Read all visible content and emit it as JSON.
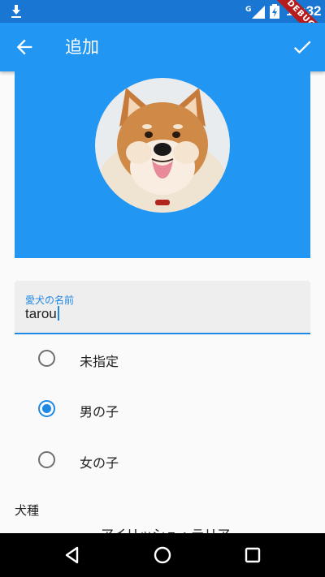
{
  "status_bar": {
    "time": "16:32",
    "network": "G",
    "debug_banner": "DEBUG"
  },
  "app_bar": {
    "title": "追加"
  },
  "profile": {
    "photo": "shiba-inu-dog-photo"
  },
  "name_field": {
    "label": "愛犬の名前",
    "value": "tarou"
  },
  "gender_options": [
    {
      "label": "未指定",
      "selected": false
    },
    {
      "label": "男の子",
      "selected": true
    },
    {
      "label": "女の子",
      "selected": false
    }
  ],
  "breed": {
    "label": "犬種",
    "value": "アイリッシュ・テリア"
  },
  "icons": [
    "download-icon",
    "signal-icon",
    "battery-charging-icon",
    "back-arrow-icon",
    "check-icon",
    "nav-back-icon",
    "nav-home-icon",
    "nav-recents-icon"
  ],
  "colors": {
    "primary": "#2196f3",
    "accent": "#1e88e5",
    "status_bar": "#1976d2"
  }
}
